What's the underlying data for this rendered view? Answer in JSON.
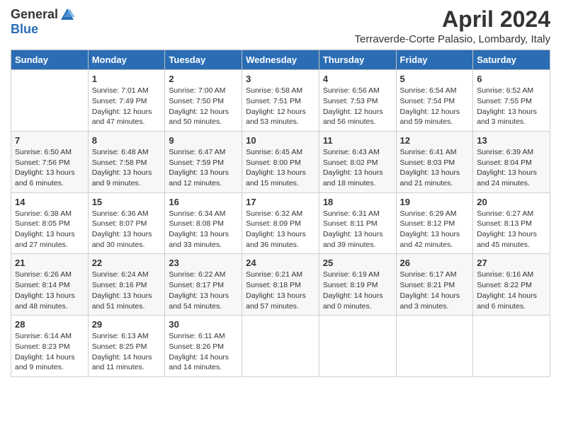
{
  "header": {
    "logo_general": "General",
    "logo_blue": "Blue",
    "title": "April 2024",
    "location": "Terraverde-Corte Palasio, Lombardy, Italy"
  },
  "calendar": {
    "days_of_week": [
      "Sunday",
      "Monday",
      "Tuesday",
      "Wednesday",
      "Thursday",
      "Friday",
      "Saturday"
    ],
    "weeks": [
      [
        {
          "day": "",
          "info": ""
        },
        {
          "day": "1",
          "info": "Sunrise: 7:01 AM\nSunset: 7:49 PM\nDaylight: 12 hours\nand 47 minutes."
        },
        {
          "day": "2",
          "info": "Sunrise: 7:00 AM\nSunset: 7:50 PM\nDaylight: 12 hours\nand 50 minutes."
        },
        {
          "day": "3",
          "info": "Sunrise: 6:58 AM\nSunset: 7:51 PM\nDaylight: 12 hours\nand 53 minutes."
        },
        {
          "day": "4",
          "info": "Sunrise: 6:56 AM\nSunset: 7:53 PM\nDaylight: 12 hours\nand 56 minutes."
        },
        {
          "day": "5",
          "info": "Sunrise: 6:54 AM\nSunset: 7:54 PM\nDaylight: 12 hours\nand 59 minutes."
        },
        {
          "day": "6",
          "info": "Sunrise: 6:52 AM\nSunset: 7:55 PM\nDaylight: 13 hours\nand 3 minutes."
        }
      ],
      [
        {
          "day": "7",
          "info": "Sunrise: 6:50 AM\nSunset: 7:56 PM\nDaylight: 13 hours\nand 6 minutes."
        },
        {
          "day": "8",
          "info": "Sunrise: 6:48 AM\nSunset: 7:58 PM\nDaylight: 13 hours\nand 9 minutes."
        },
        {
          "day": "9",
          "info": "Sunrise: 6:47 AM\nSunset: 7:59 PM\nDaylight: 13 hours\nand 12 minutes."
        },
        {
          "day": "10",
          "info": "Sunrise: 6:45 AM\nSunset: 8:00 PM\nDaylight: 13 hours\nand 15 minutes."
        },
        {
          "day": "11",
          "info": "Sunrise: 6:43 AM\nSunset: 8:02 PM\nDaylight: 13 hours\nand 18 minutes."
        },
        {
          "day": "12",
          "info": "Sunrise: 6:41 AM\nSunset: 8:03 PM\nDaylight: 13 hours\nand 21 minutes."
        },
        {
          "day": "13",
          "info": "Sunrise: 6:39 AM\nSunset: 8:04 PM\nDaylight: 13 hours\nand 24 minutes."
        }
      ],
      [
        {
          "day": "14",
          "info": "Sunrise: 6:38 AM\nSunset: 8:05 PM\nDaylight: 13 hours\nand 27 minutes."
        },
        {
          "day": "15",
          "info": "Sunrise: 6:36 AM\nSunset: 8:07 PM\nDaylight: 13 hours\nand 30 minutes."
        },
        {
          "day": "16",
          "info": "Sunrise: 6:34 AM\nSunset: 8:08 PM\nDaylight: 13 hours\nand 33 minutes."
        },
        {
          "day": "17",
          "info": "Sunrise: 6:32 AM\nSunset: 8:09 PM\nDaylight: 13 hours\nand 36 minutes."
        },
        {
          "day": "18",
          "info": "Sunrise: 6:31 AM\nSunset: 8:11 PM\nDaylight: 13 hours\nand 39 minutes."
        },
        {
          "day": "19",
          "info": "Sunrise: 6:29 AM\nSunset: 8:12 PM\nDaylight: 13 hours\nand 42 minutes."
        },
        {
          "day": "20",
          "info": "Sunrise: 6:27 AM\nSunset: 8:13 PM\nDaylight: 13 hours\nand 45 minutes."
        }
      ],
      [
        {
          "day": "21",
          "info": "Sunrise: 6:26 AM\nSunset: 8:14 PM\nDaylight: 13 hours\nand 48 minutes."
        },
        {
          "day": "22",
          "info": "Sunrise: 6:24 AM\nSunset: 8:16 PM\nDaylight: 13 hours\nand 51 minutes."
        },
        {
          "day": "23",
          "info": "Sunrise: 6:22 AM\nSunset: 8:17 PM\nDaylight: 13 hours\nand 54 minutes."
        },
        {
          "day": "24",
          "info": "Sunrise: 6:21 AM\nSunset: 8:18 PM\nDaylight: 13 hours\nand 57 minutes."
        },
        {
          "day": "25",
          "info": "Sunrise: 6:19 AM\nSunset: 8:19 PM\nDaylight: 14 hours\nand 0 minutes."
        },
        {
          "day": "26",
          "info": "Sunrise: 6:17 AM\nSunset: 8:21 PM\nDaylight: 14 hours\nand 3 minutes."
        },
        {
          "day": "27",
          "info": "Sunrise: 6:16 AM\nSunset: 8:22 PM\nDaylight: 14 hours\nand 6 minutes."
        }
      ],
      [
        {
          "day": "28",
          "info": "Sunrise: 6:14 AM\nSunset: 8:23 PM\nDaylight: 14 hours\nand 9 minutes."
        },
        {
          "day": "29",
          "info": "Sunrise: 6:13 AM\nSunset: 8:25 PM\nDaylight: 14 hours\nand 11 minutes."
        },
        {
          "day": "30",
          "info": "Sunrise: 6:11 AM\nSunset: 8:26 PM\nDaylight: 14 hours\nand 14 minutes."
        },
        {
          "day": "",
          "info": ""
        },
        {
          "day": "",
          "info": ""
        },
        {
          "day": "",
          "info": ""
        },
        {
          "day": "",
          "info": ""
        }
      ]
    ]
  }
}
